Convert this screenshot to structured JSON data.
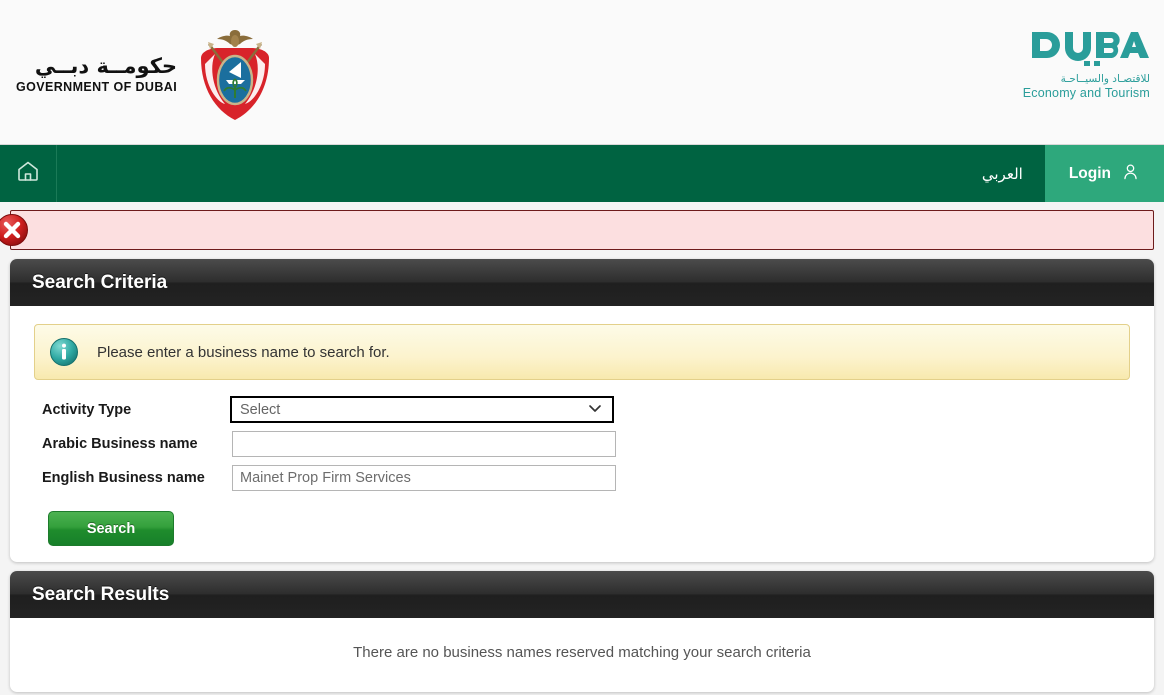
{
  "header": {
    "gov_logo": {
      "arabic": "حكومــة دبــي",
      "english": "GOVERNMENT OF DUBAI",
      "emblem_icon": "dubai-emblem-icon"
    },
    "det_logo": {
      "wordmark": "DUBAI",
      "arabic": "للاقتصـاد والسيــاحـة",
      "english": "Economy and Tourism"
    }
  },
  "navbar": {
    "home_icon": "home-icon",
    "language_label": "العربي",
    "login_label": "Login",
    "login_icon": "user-icon",
    "bar_color": "#006341",
    "login_color": "#2ea87c"
  },
  "alert": {
    "icon": "error-circle-icon",
    "message": ""
  },
  "search_criteria": {
    "title": "Search Criteria",
    "info": {
      "icon": "info-circle-icon",
      "text": "Please enter a business name to search for."
    },
    "fields": {
      "activity_type": {
        "label": "Activity Type",
        "value": "Select",
        "chevron_icon": "chevron-down-icon"
      },
      "arabic_business_name": {
        "label": "Arabic Business name",
        "value": "",
        "placeholder": ""
      },
      "english_business_name": {
        "label": "English Business name",
        "value": "Mainet Prop Firm Services",
        "placeholder": ""
      }
    },
    "search_button": "Search"
  },
  "search_results": {
    "title": "Search Results",
    "empty_message": "There are no business names reserved matching your search criteria"
  }
}
